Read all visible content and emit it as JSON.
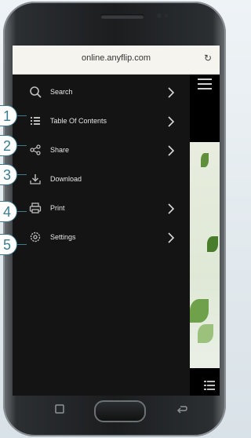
{
  "browser": {
    "url": "online.anyflip.com",
    "reload_icon": "reload-icon"
  },
  "menu": {
    "items": [
      {
        "label": "Search",
        "icon": "search-icon",
        "has_arrow": true
      },
      {
        "label": "Table Of Contents",
        "icon": "list-icon",
        "has_arrow": true
      },
      {
        "label": "Share",
        "icon": "share-icon",
        "has_arrow": true
      },
      {
        "label": "Download",
        "icon": "download-icon",
        "has_arrow": false
      },
      {
        "label": "Print",
        "icon": "print-icon",
        "has_arrow": true
      },
      {
        "label": "Settings",
        "icon": "gear-icon",
        "has_arrow": true
      }
    ]
  },
  "callouts": [
    "1",
    "2",
    "3",
    "4",
    "5"
  ],
  "colors": {
    "menu_background": "#141414",
    "callout_accent": "#3a7d8f"
  }
}
